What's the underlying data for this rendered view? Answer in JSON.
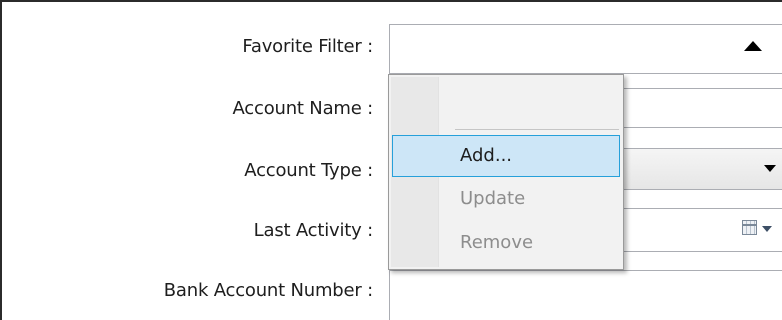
{
  "form": {
    "fields": [
      {
        "label": "Favorite Filter :",
        "control": "combo-open",
        "value": ""
      },
      {
        "label": "Account Name :",
        "control": "text",
        "value": ""
      },
      {
        "label": "Account Type :",
        "control": "combo",
        "value": ""
      },
      {
        "label": "Last Activity :",
        "control": "date",
        "value": ""
      },
      {
        "label": "Bank Account Number :",
        "control": "text",
        "value": ""
      }
    ]
  },
  "context_menu": {
    "items": [
      {
        "label": "Add...",
        "state": "highlighted"
      },
      {
        "label": "Update",
        "state": "disabled"
      },
      {
        "label": "Remove",
        "state": "disabled"
      }
    ]
  },
  "icons": {
    "dropdown_open": "triangle-up-icon",
    "dropdown_closed": "triangle-down-icon",
    "date_picker": "calendar-icon"
  },
  "colors": {
    "highlight_fill": "#cde6f7",
    "highlight_border": "#26a0da",
    "disabled_text": "#8d8d8d",
    "field_border": "#abadb3"
  }
}
